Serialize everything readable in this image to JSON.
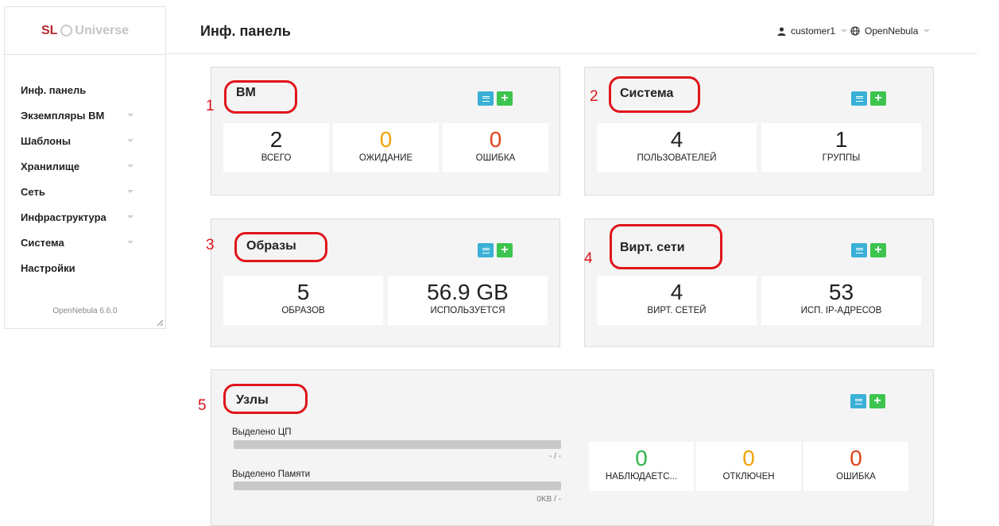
{
  "sidebar": {
    "logo_sl": "SL",
    "logo_universe": "Universe",
    "items": [
      {
        "label": "Инф. панель"
      },
      {
        "label": "Экземпляры ВМ"
      },
      {
        "label": "Шаблоны"
      },
      {
        "label": "Хранилище"
      },
      {
        "label": "Сеть"
      },
      {
        "label": "Инфраструктура"
      },
      {
        "label": "Система"
      },
      {
        "label": "Настройки"
      }
    ],
    "version": "OpenNebula 6.6.0"
  },
  "header": {
    "title": "Инф. панель",
    "user": "customer1",
    "zone": "OpenNebula"
  },
  "panels": {
    "vm": {
      "title": "ВМ",
      "annotation": "1",
      "stats": [
        {
          "value": "2",
          "label": "ВСЕГО"
        },
        {
          "value": "0",
          "label": "ОЖИДАНИЕ"
        },
        {
          "value": "0",
          "label": "ОШИБКА"
        }
      ]
    },
    "system": {
      "title": "Система",
      "annotation": "2",
      "stats": [
        {
          "value": "4",
          "label": "ПОЛЬЗОВАТЕЛЕЙ"
        },
        {
          "value": "1",
          "label": "ГРУППЫ"
        }
      ]
    },
    "images": {
      "title": "Образы",
      "annotation": "3",
      "stats": [
        {
          "value": "5",
          "label": "ОБРАЗОВ"
        },
        {
          "value": "56.9 GB",
          "label": "ИСПОЛЬЗУЕТСЯ"
        }
      ]
    },
    "vnets": {
      "title": "Вирт. сети",
      "annotation": "4",
      "stats": [
        {
          "value": "4",
          "label": "ВИРТ. СЕТЕЙ"
        },
        {
          "value": "53",
          "label": "ИСП. IP-АДРЕСОВ"
        }
      ]
    },
    "hosts": {
      "title": "Узлы",
      "annotation": "5",
      "cpu_label": "Выделено ЦП",
      "cpu_value": "- / -",
      "mem_label": "Выделено Памяти",
      "mem_value": "0KB / -",
      "stats": [
        {
          "value": "0",
          "label": "НАБЛЮДАЕТС..."
        },
        {
          "value": "0",
          "label": "ОТКЛЮЧЕН"
        },
        {
          "value": "0",
          "label": "ОШИБКА"
        }
      ]
    }
  },
  "colors": {
    "annotation": "#e0151b",
    "list_button": "#3ab0d6",
    "add_button": "#3dc44e",
    "warning": "#f0a30a",
    "error": "#e0431b",
    "ok": "#2fb54a"
  }
}
